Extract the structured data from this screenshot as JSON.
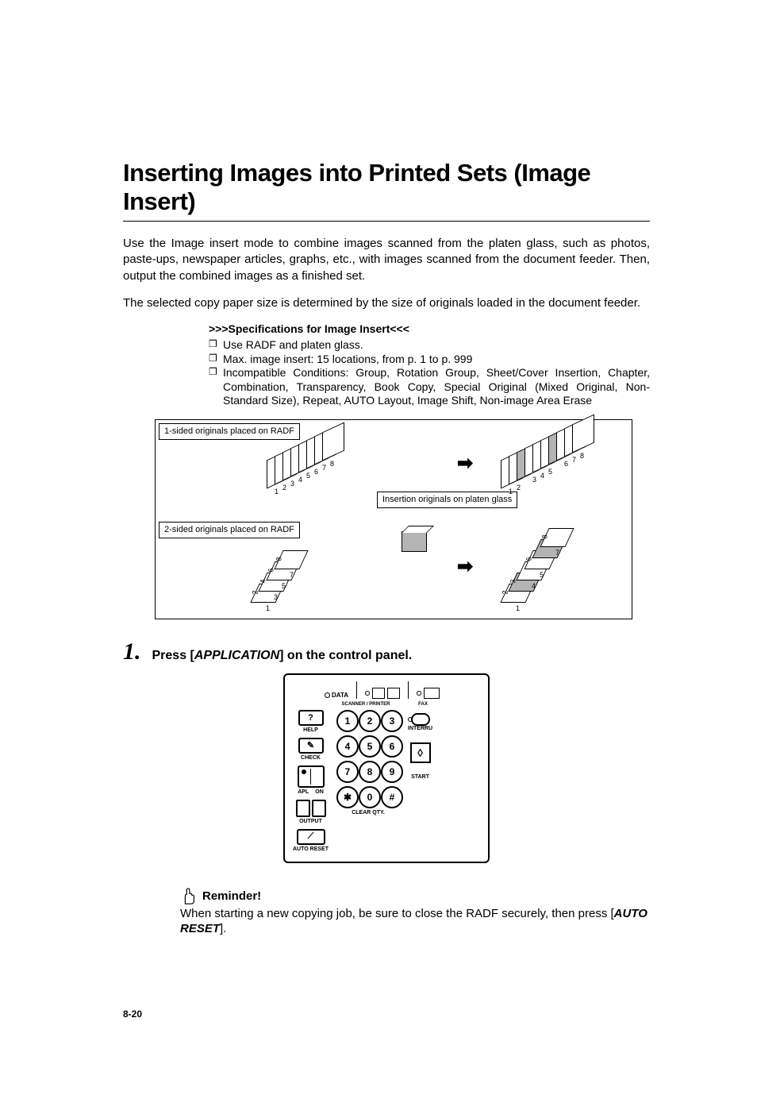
{
  "title": "Inserting Images into Printed Sets (Image Insert)",
  "intro_p1": "Use the Image insert mode to combine images scanned from the platen glass, such as photos, paste-ups, newspaper articles, graphs, etc., with images scanned from the document feeder. Then, output the combined images as a finished set.",
  "intro_p2": "The selected copy paper size is determined by the size of originals loaded in the document feeder.",
  "spec_head": ">>>Specifications for Image Insert<<<",
  "spec1": "Use RADF and platen glass.",
  "spec2": "Max. image insert: 15 locations, from p. 1 to p. 999",
  "spec3": "Incompatible Conditions: Group, Rotation Group, Sheet/Cover Insertion, Chapter, Combination, Transparency, Book Copy, Special Original (Mixed Original, Non-Standard Size), Repeat, AUTO Layout, Image Shift, Non-image Area Erase",
  "diagram": {
    "label_1sided": "1-sided originals placed on RADF",
    "label_2sided": "2-sided originals placed on RADF",
    "label_insertion": "Insertion originals on platen glass",
    "nums": [
      "1",
      "2",
      "3",
      "4",
      "5",
      "6",
      "7",
      "8"
    ]
  },
  "step": {
    "num": "1.",
    "pre": "Press [",
    "app": "APPLICATION",
    "post": "] on the control panel."
  },
  "panel": {
    "data": "DATA",
    "scanner": "SCANNER / PRINTER",
    "fax": "FAX",
    "help": "HELP",
    "check": "CHECK",
    "apl": "APL",
    "on": "ON",
    "output": "OUTPUT",
    "autoreset": "AUTO RESET",
    "interrupt": "INTERRU",
    "start": "START",
    "clearqty": "CLEAR QTY.",
    "keys": [
      "1",
      "2",
      "3",
      "4",
      "5",
      "6",
      "7",
      "8",
      "9",
      "✱",
      "0",
      "#"
    ]
  },
  "reminder": {
    "head": "Reminder!",
    "text_pre": "When starting a new copying job, be sure to close the RADF securely, then press [",
    "autoreset": "AUTO RESET",
    "text_post": "]."
  },
  "pagenum": "8-20"
}
